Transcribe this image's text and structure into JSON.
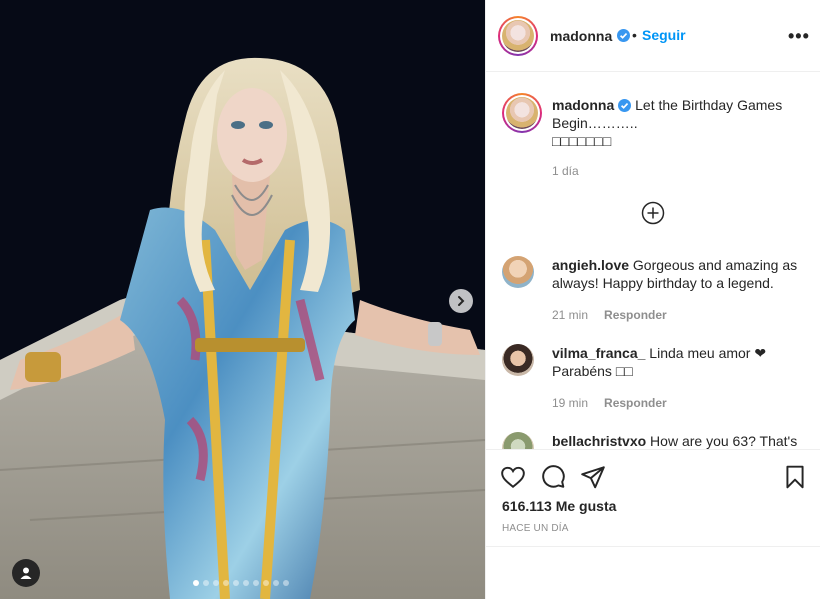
{
  "post": {
    "image_alt": "Photo",
    "carousel": {
      "count": 10,
      "active": 0
    }
  },
  "header": {
    "username": "madonna",
    "separator": "•",
    "follow_label": "Seguir",
    "more_label": "•••"
  },
  "caption": {
    "username": "madonna",
    "text": "Let the Birthday Games Begin………..",
    "text_line2": "□□□□□□□",
    "time": "1 día"
  },
  "comments": [
    {
      "username": "angieh.love",
      "text": "Gorgeous and amazing as always! Happy birthday to a legend.",
      "time": "21 min",
      "reply": "Responder"
    },
    {
      "username": "vilma_franca_",
      "text": "Linda meu amor ❤ Parabéns □□",
      "time": "19 min",
      "reply": "Responder"
    },
    {
      "username": "bellachristvxo",
      "text": "How are you 63? That's"
    }
  ],
  "footer": {
    "likes": "616.113 Me gusta",
    "timestamp": "HACE UN DÍA"
  },
  "colors": {
    "accent": "#0095f6",
    "text": "#262626",
    "muted": "#8e8e8e",
    "border": "#efefef"
  }
}
